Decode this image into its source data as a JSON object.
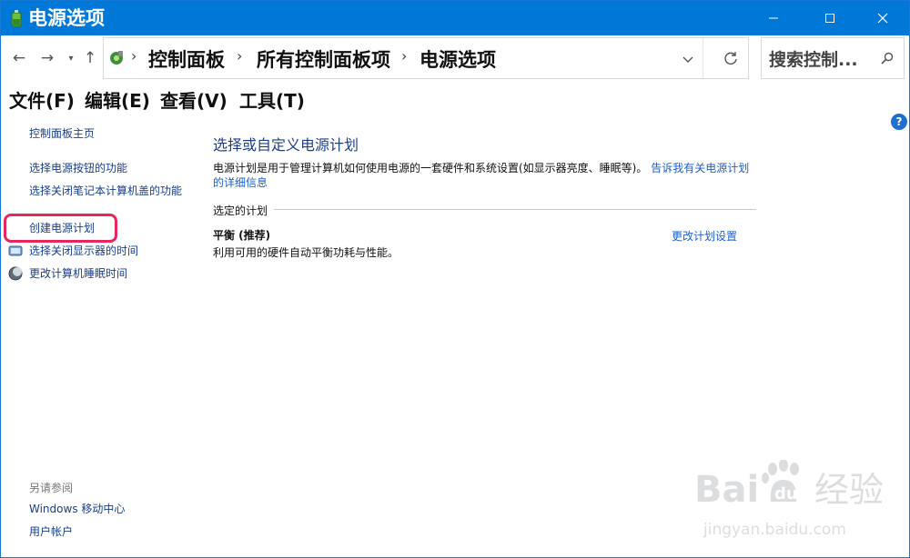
{
  "window": {
    "title": "电源选项",
    "min_icon": "minimize-icon",
    "max_icon": "maximize-icon",
    "close_icon": "close-icon",
    "accent": "#0078d7"
  },
  "address": {
    "breadcrumbs": [
      "控制面板",
      "所有控制面板项",
      "电源选项"
    ],
    "search_placeholder": "搜索控制..."
  },
  "menu": [
    "文件(F)",
    "编辑(E)",
    "查看(V)",
    "工具(T)"
  ],
  "help": "?",
  "sidebar": {
    "home": "控制面板主页",
    "links": [
      "选择电源按钮的功能",
      "选择关闭笔记本计算机盖的功能",
      "创建电源计划",
      "选择关闭显示器的时间",
      "更改计算机睡眠时间"
    ],
    "see_also_title": "另请参阅",
    "see_also": [
      "Windows 移动中心",
      "用户帐户"
    ],
    "highlight_color": "#e8265e"
  },
  "main": {
    "heading": "选择或自定义电源计划",
    "desc": "电源计划是用于管理计算机如何使用电源的一套硬件和系统设置(如显示器亮度、睡眠等)。",
    "desc_link": "告诉我有关电源计划的详细信息",
    "section": "选定的计划",
    "plan_name": "平衡 (推荐)",
    "plan_desc": "利用可用的硬件自动平衡功耗与性能。",
    "plan_link": "更改计划设置"
  },
  "watermark": {
    "logo_text": "Bai du 经验",
    "url": "jingyan.baidu.com"
  }
}
